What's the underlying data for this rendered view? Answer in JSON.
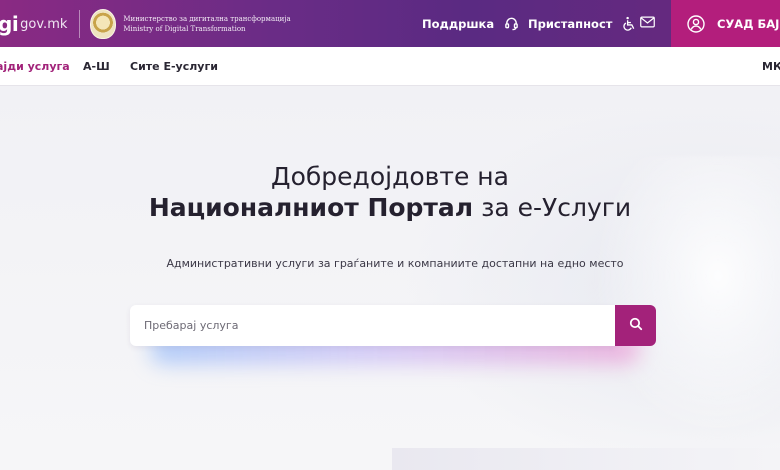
{
  "header": {
    "logo_text": "gi",
    "logo_domain": "gov.mk",
    "ministry_mk": "Министерство за дигитална трансформација",
    "ministry_en": "Ministry of Digital Transformation",
    "support_label": "Поддршка",
    "support_icon": "headset-icon",
    "accessibility_label": "Пристапност",
    "accessibility_icon": "wheelchair-icon",
    "mail_icon": "envelope-icon",
    "user_name": "СУАД БАЈРА",
    "user_icon": "user-icon",
    "colors": {
      "bar": "#6a2c86",
      "user_box": "#b31e7c"
    }
  },
  "subnav": {
    "find_service": "ајди услуга",
    "a_z": "А-Ш",
    "all_eservices": "Сите Е-услуги",
    "language": "МК"
  },
  "hero": {
    "title_line1": "Добредојдовте на",
    "title_bold": "Националниот Портал",
    "title_rest": "за е-Услуги",
    "subtitle": "Административни услуги за граѓаните и компаниите достапни на едно место"
  },
  "search": {
    "placeholder": "Пребарај услуга",
    "value": "",
    "button_icon": "search-icon",
    "accent": "#a3227a"
  }
}
